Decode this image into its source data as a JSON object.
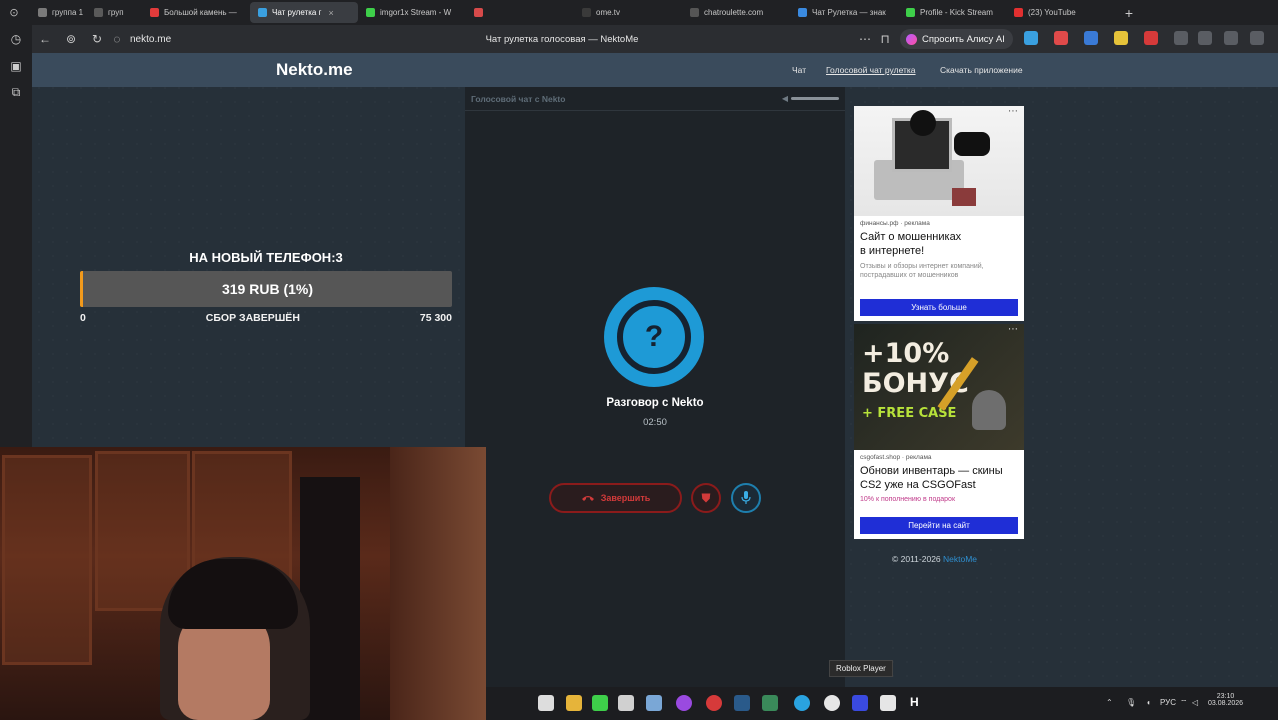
{
  "browser": {
    "tabs": [
      {
        "label": "группа 1",
        "active": false,
        "color": "#7a7a7a"
      },
      {
        "label": "груп",
        "active": false,
        "color": "#5a5a5a"
      },
      {
        "label": "Большой камень —",
        "active": false,
        "color": "#e23b3b"
      },
      {
        "label": "Чат рулетка г",
        "active": true,
        "color": "#3aa0e0"
      },
      {
        "label": "imgor1x Stream - W",
        "active": false,
        "color": "#3ecf4a"
      },
      {
        "label": "",
        "active": false,
        "color": "#d64a4a"
      },
      {
        "label": "ome.tv",
        "active": false,
        "color": "#3a3a3a"
      },
      {
        "label": "chatroulette.com",
        "active": false,
        "color": "#555"
      },
      {
        "label": "Чат Рулетка — знак",
        "active": false,
        "color": "#3a8ae0"
      },
      {
        "label": "Profile - Kick Stream",
        "active": false,
        "color": "#3ecf4a"
      },
      {
        "label": "(23) YouTube",
        "active": false,
        "color": "#e23030"
      }
    ],
    "url": "nekto.me",
    "page_title": "Чат рулетка голосовая — NektoMe",
    "alisa_label": "Спросить Алису AI"
  },
  "site": {
    "logo": "Nekto.me",
    "nav": [
      {
        "label": "Чат",
        "active": false
      },
      {
        "label": "Голосовой чат рулетка",
        "active": true
      },
      {
        "label": "Скачать приложение",
        "active": false
      }
    ]
  },
  "goal": {
    "title": "НА НОВЫЙ ТЕЛЕФОН:3",
    "amount": "319 RUB (1%)",
    "progress": 0.01,
    "min": "0",
    "status": "СБОР ЗАВЕРШЁН",
    "max": "75 300",
    "accent": "#f29a1c"
  },
  "call": {
    "header": "Голосовой чат с Nekto",
    "avatar_glyph": "?",
    "partner": "Разговор с Nekto",
    "timer": "02:50",
    "end_label": "Завершить",
    "end_icon": "phone-hangup-icon",
    "accent_red": "#d23a3a",
    "accent_blue": "#1e9ad6"
  },
  "ads": [
    {
      "source": "финансы.рф · реклама",
      "headline_1": "Сайт о мошенниках",
      "headline_2": "в интернете!",
      "description": "Отзывы и обзоры интернет компаний, пострадавших от мошенников",
      "cta": "Узнать больше"
    },
    {
      "image_line_1": "+10%",
      "image_line_2": "БОНУС",
      "image_line_3": "+ FREE CASE",
      "source": "csgofast.shop · реклама",
      "headline_1": "Обнови инвентарь — скины",
      "headline_2": "CS2 уже на CSGOFast",
      "promo": "10% к пополнению в подарок",
      "cta": "Перейти на сайт"
    }
  ],
  "footer": {
    "copyright": "© 2011-2026 ",
    "brand": "NektoMe"
  },
  "taskbar": {
    "tooltip": "Roblox Player",
    "lang": "РУС",
    "time": "23:10",
    "date": "03.08.2026"
  }
}
